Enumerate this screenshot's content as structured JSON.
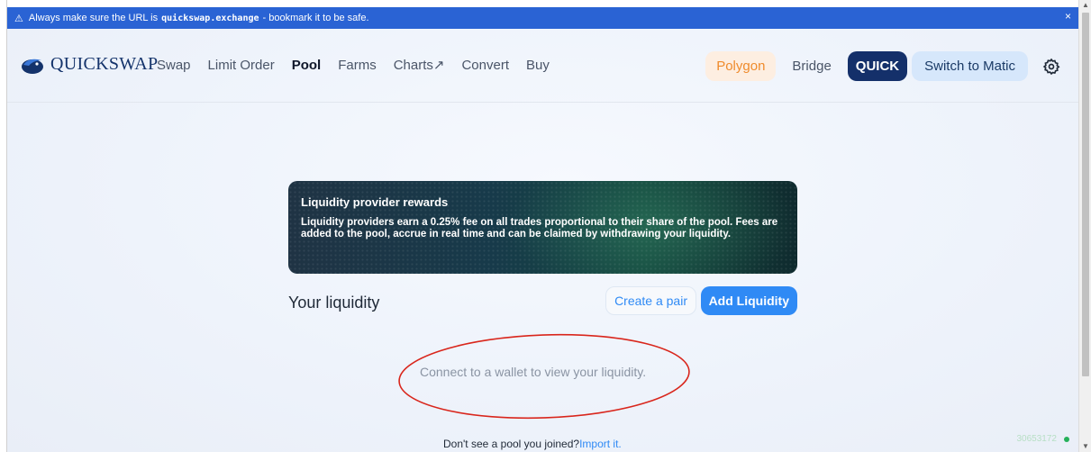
{
  "banner": {
    "prefix": "Always make sure the URL is",
    "url": "quickswap.exchange",
    "suffix": "- bookmark it to be safe.",
    "close": "×"
  },
  "header": {
    "logo_text": "QUICKSWAP",
    "nav": [
      {
        "label": "Swap"
      },
      {
        "label": "Limit Order"
      },
      {
        "label": "Pool",
        "active": true
      },
      {
        "label": "Farms"
      },
      {
        "label": "Charts↗"
      },
      {
        "label": "Convert"
      },
      {
        "label": "Buy"
      }
    ],
    "network": "Polygon",
    "bridge": "Bridge",
    "quick": "QUICK",
    "switch": "Switch to Matic"
  },
  "rewards": {
    "title": "Liquidity provider rewards",
    "body": "Liquidity providers earn a 0.25% fee on all trades proportional to their share of the pool. Fees are added to the pool, accrue in real time and can be claimed by withdrawing your liquidity."
  },
  "liquidity": {
    "title": "Your liquidity",
    "create_pair": "Create a pair",
    "add_liquidity": "Add Liquidity",
    "connect_message": "Connect to a wallet to view your liquidity."
  },
  "footer": {
    "question": "Don't see a pool you joined?",
    "import_link": "Import it."
  },
  "block_number": "30653172",
  "colors": {
    "accent": "#2f8af5",
    "brand": "#14306a",
    "banner": "#2a63d4",
    "annotation": "#d9261c"
  }
}
